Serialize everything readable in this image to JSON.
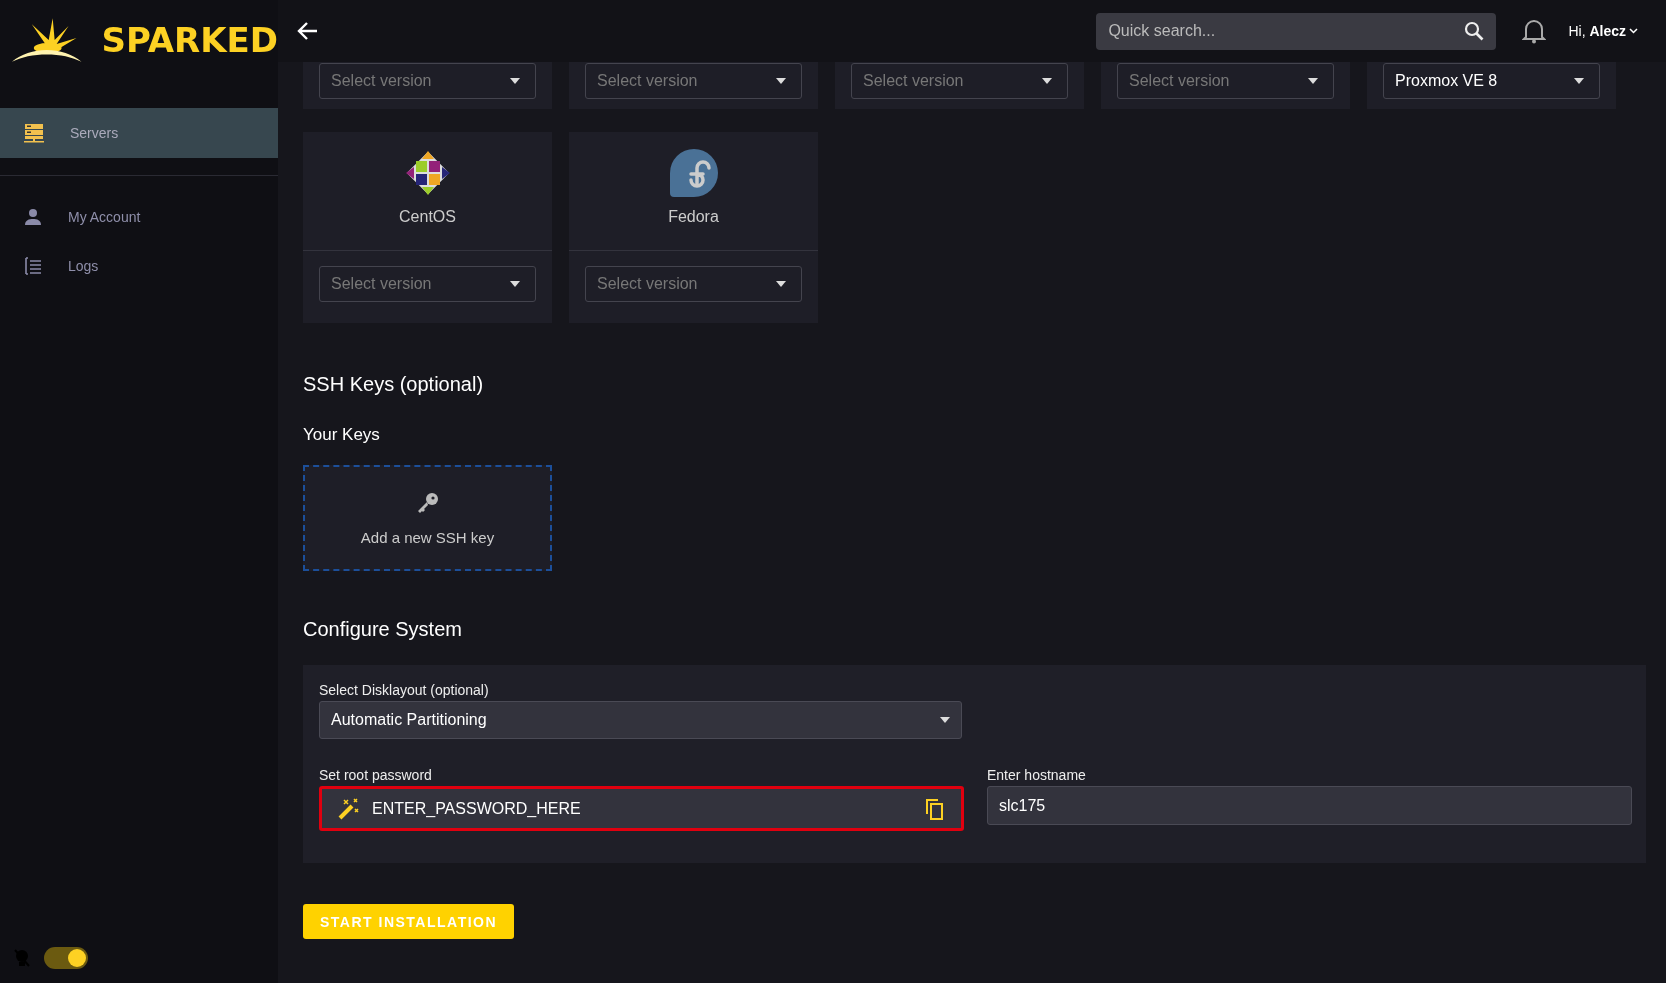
{
  "sidebar": {
    "brand": "SPARKED",
    "items": [
      {
        "label": "Servers",
        "kind": "servers",
        "selected": true
      },
      {
        "label": "My Account",
        "kind": "account",
        "selected": false
      },
      {
        "label": "Logs",
        "kind": "logs",
        "selected": false
      }
    ],
    "theme_toggle": {
      "on": true
    }
  },
  "topbar": {
    "search": {
      "placeholder": "Quick search..."
    },
    "greeting": "Hi, **Alecz**"
  },
  "os_cards_top": [
    {
      "placeholder": "Select version"
    },
    {
      "placeholder": "Select version"
    },
    {
      "placeholder": "Select version"
    },
    {
      "placeholder": "Select version"
    },
    {
      "value": "Proxmox VE 8"
    }
  ],
  "os_cards": [
    {
      "name": "CentOS",
      "kind": "centos",
      "placeholder": "Select version"
    },
    {
      "name": "Fedora",
      "kind": "fedora",
      "placeholder": "Select version"
    }
  ],
  "ssh": {
    "title": "SSH Keys (optional)",
    "subtitle": "Your Keys",
    "add_label": "Add a new SSH key"
  },
  "configure": {
    "title": "Configure System",
    "disk_layout": {
      "label": "Select Disklayout (optional)",
      "value": "Automatic Partitioning"
    },
    "root_password": {
      "label": "Set root password",
      "value": "ENTER_PASSWORD_HERE",
      "highlighted": true
    },
    "hostname": {
      "label": "Enter hostname",
      "value": "slc175"
    }
  },
  "start_button": "START INSTALLATION"
}
